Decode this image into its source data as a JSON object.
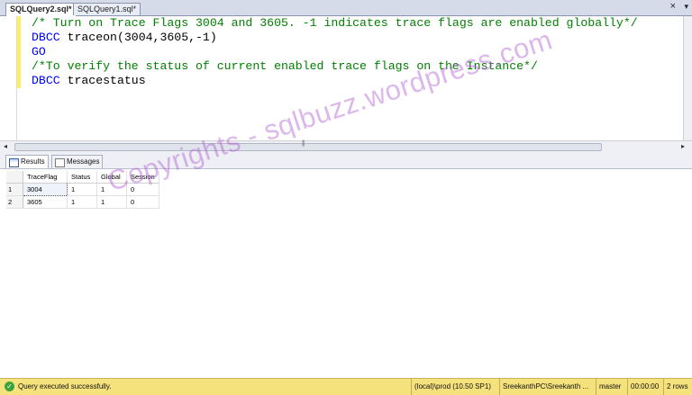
{
  "tabs": [
    {
      "label": "SQLQuery2.sql*",
      "active": true
    },
    {
      "label": "SQLQuery1.sql*",
      "active": false
    }
  ],
  "editor": {
    "lines": [
      {
        "type": "comment",
        "text": "/* Turn on Trace Flags 3004 and 3605. -1 indicates trace flags are enabled globally*/"
      },
      {
        "keyword": "DBCC",
        "rest": " traceon(3004,3605,-1)"
      },
      {
        "keyword": "GO",
        "rest": ""
      },
      {
        "type": "comment",
        "text": "/*To verify the status of current enabled trace flags on the Instance*/"
      },
      {
        "keyword": "DBCC",
        "rest": " tracestatus"
      }
    ]
  },
  "results": {
    "tabs": [
      {
        "label": "Results",
        "icon": "grid-icon"
      },
      {
        "label": "Messages",
        "icon": "messages-icon"
      }
    ],
    "columns": [
      "TraceFlag",
      "Status",
      "Global",
      "Session"
    ],
    "rows": [
      {
        "num": "1",
        "cells": [
          "3004",
          "1",
          "1",
          "0"
        ]
      },
      {
        "num": "2",
        "cells": [
          "3605",
          "1",
          "1",
          "0"
        ]
      }
    ]
  },
  "watermark": "Copyrights - sqlbuzz.wordpress.com",
  "statusbar": {
    "message": "Query executed successfully.",
    "server": "(local)\\prod (10.50 SP1)",
    "user": "SreekanthPC\\Sreekanth ...",
    "database": "master",
    "time": "00:00:00",
    "rows": "2 rows"
  },
  "colors": {
    "statusbar_bg": "#f6e27d",
    "comment": "#008000",
    "keyword": "#0000ff",
    "watermark": "#b06fd8"
  }
}
